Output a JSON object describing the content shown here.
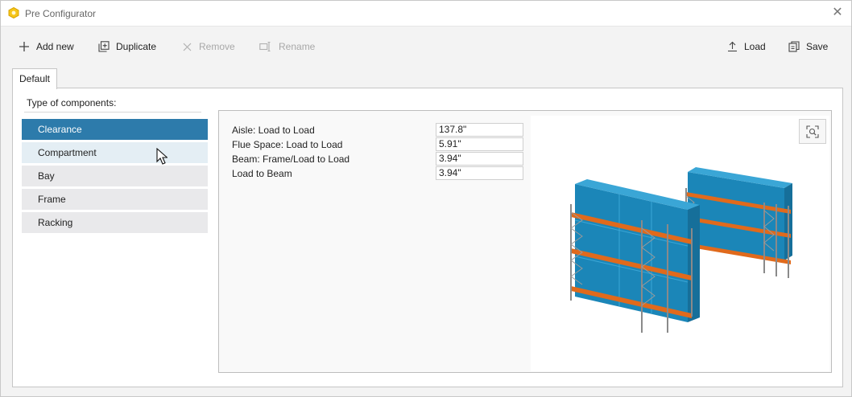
{
  "window": {
    "title": "Pre Configurator",
    "close_glyph": "✕"
  },
  "toolbar": {
    "add_new": "Add new",
    "duplicate": "Duplicate",
    "remove": "Remove",
    "rename": "Rename",
    "load": "Load",
    "save": "Save"
  },
  "tabs": [
    {
      "label": "Default"
    }
  ],
  "components": {
    "label": "Type of components:",
    "items": [
      {
        "label": "Clearance",
        "state": "selected"
      },
      {
        "label": "Compartment",
        "state": "hover"
      },
      {
        "label": "Bay",
        "state": "normal"
      },
      {
        "label": "Frame",
        "state": "normal"
      },
      {
        "label": "Racking",
        "state": "normal"
      }
    ]
  },
  "properties": [
    {
      "label": "Aisle: Load to Load",
      "value": "137.8\""
    },
    {
      "label": "Flue Space: Load to Load",
      "value": "5.91\""
    },
    {
      "label": "Beam: Frame/Load to Load",
      "value": "3.94\""
    },
    {
      "label": "Load to Beam",
      "value": "3.94\""
    }
  ],
  "colors": {
    "accent": "#2d7bab",
    "box": "#1f8fc0",
    "beam": "#e06a1c",
    "upright": "#8a8a8a"
  },
  "icons": [
    "app-icon",
    "close-icon",
    "plus-icon",
    "duplicate-icon",
    "remove-icon",
    "rename-icon",
    "load-icon",
    "save-icon",
    "zoom-fit-icon",
    "mouse-cursor-icon"
  ]
}
